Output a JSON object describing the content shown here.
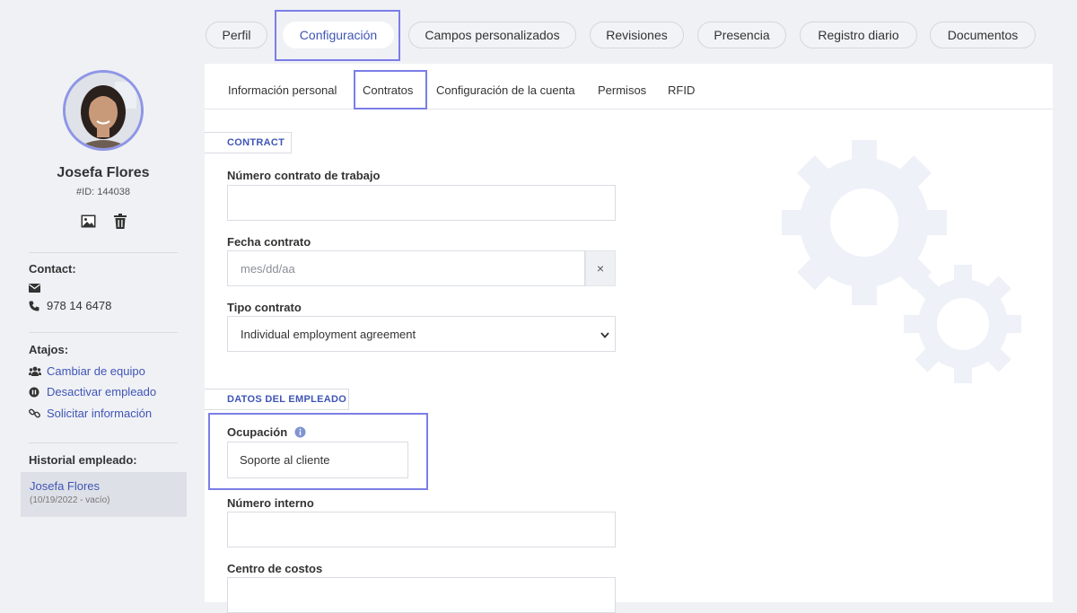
{
  "top_tabs": [
    {
      "label": "Perfil",
      "active": false
    },
    {
      "label": "Configuración",
      "active": true
    },
    {
      "label": "Campos personalizados",
      "active": false
    },
    {
      "label": "Revisiones",
      "active": false
    },
    {
      "label": "Presencia",
      "active": false
    },
    {
      "label": "Registro diario",
      "active": false
    },
    {
      "label": "Documentos",
      "active": false
    }
  ],
  "employee": {
    "name": "Josefa Flores",
    "id_label": "#ID: 144038"
  },
  "contact": {
    "heading": "Contact:",
    "phone": "978 14 6478"
  },
  "shortcuts": {
    "heading": "Atajos:",
    "items": [
      "Cambiar de equipo",
      "Desactivar empleado",
      "Solicitar información"
    ]
  },
  "history": {
    "heading": "Historial empleado:",
    "name": "Josefa Flores",
    "sub": "(10/19/2022 - vacío)"
  },
  "sub_tabs": [
    {
      "label": "Información personal",
      "active": false
    },
    {
      "label": "Contratos",
      "active": true
    },
    {
      "label": "Configuración de la cuenta",
      "active": false
    },
    {
      "label": "Permisos",
      "active": false
    },
    {
      "label": "RFID",
      "active": false
    }
  ],
  "contract_section": {
    "title": "CONTRACT",
    "contract_number_label": "Número contrato de trabajo",
    "contract_number_value": "",
    "contract_date_label": "Fecha contrato",
    "contract_date_placeholder": "mes/dd/aa",
    "clear_symbol": "×",
    "contract_type_label": "Tipo contrato",
    "contract_type_value": "Individual employment agreement"
  },
  "employee_section": {
    "title": "DATOS DEL EMPLEADO",
    "occupation_label": "Ocupación",
    "occupation_value": "Soporte al cliente",
    "internal_number_label": "Número interno",
    "internal_number_value": "",
    "cost_center_label": "Centro de costos",
    "cost_center_value": ""
  },
  "icons": [
    "image-icon",
    "trash-icon",
    "envelope-icon",
    "phone-icon",
    "users-icon",
    "pause-circle-icon",
    "link-icon",
    "info-icon",
    "chevron-down-icon",
    "gears-icon"
  ],
  "colors": {
    "accent": "#3f55b5",
    "highlight": "#7b7ee6",
    "background": "#f0f1f5"
  }
}
